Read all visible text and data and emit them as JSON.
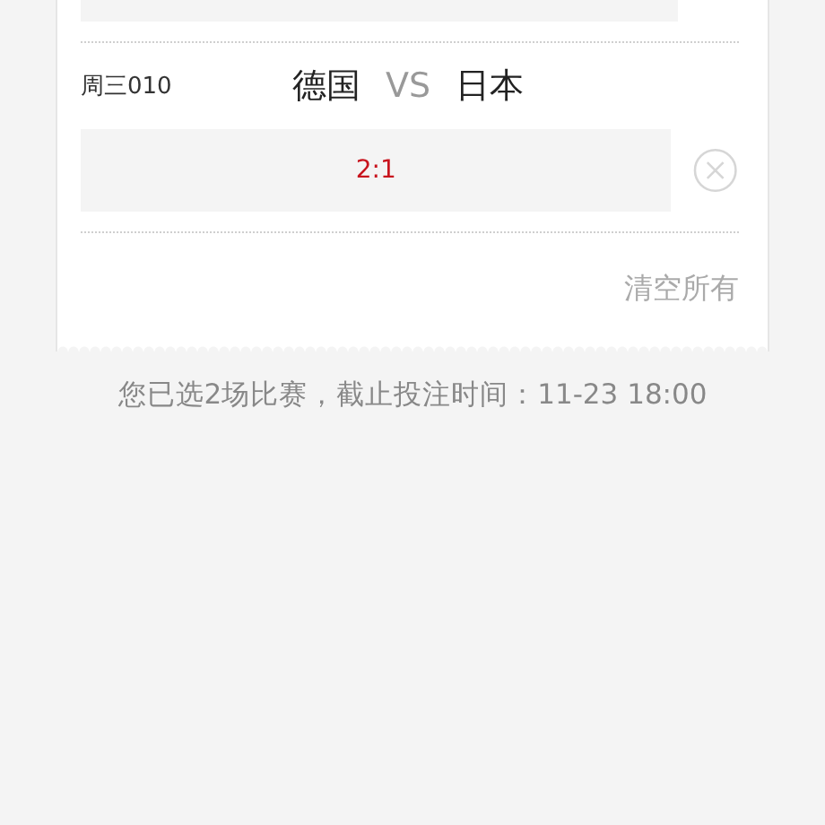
{
  "matches": [
    {
      "code": "周三010",
      "home": "德国",
      "vs": "VS",
      "away": "日本",
      "picks": [
        "2:1"
      ]
    }
  ],
  "clear_all": "清空所有",
  "summary": "您已选2场比赛，截止投注时间：11-23 18:00"
}
